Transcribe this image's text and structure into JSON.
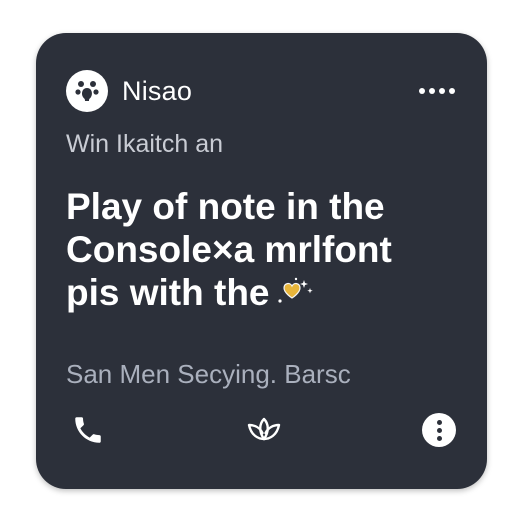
{
  "card": {
    "author": "Nisao",
    "avatar_icon": "pawprint-icon",
    "more_icon": "more-horizontal-icon",
    "subtitle": "Win Ikaitch an",
    "headline": {
      "line1": "Play of note in the",
      "line2": "Console×a mrlfont",
      "line3": "pis with the"
    },
    "headline_emoji_icon": "heart-sparkle-icon",
    "footer_text": "San Men Secying. Barsc",
    "actions": [
      {
        "icon": "phone-icon"
      },
      {
        "icon": "lotus-icon"
      },
      {
        "icon": "more-vertical-icon"
      }
    ]
  },
  "colors": {
    "card_background": "#2c303a",
    "text_primary": "#ffffff",
    "text_secondary": "#c9ccd4",
    "text_muted": "#aab0bd",
    "emoji_accent": "#e8b53a"
  }
}
